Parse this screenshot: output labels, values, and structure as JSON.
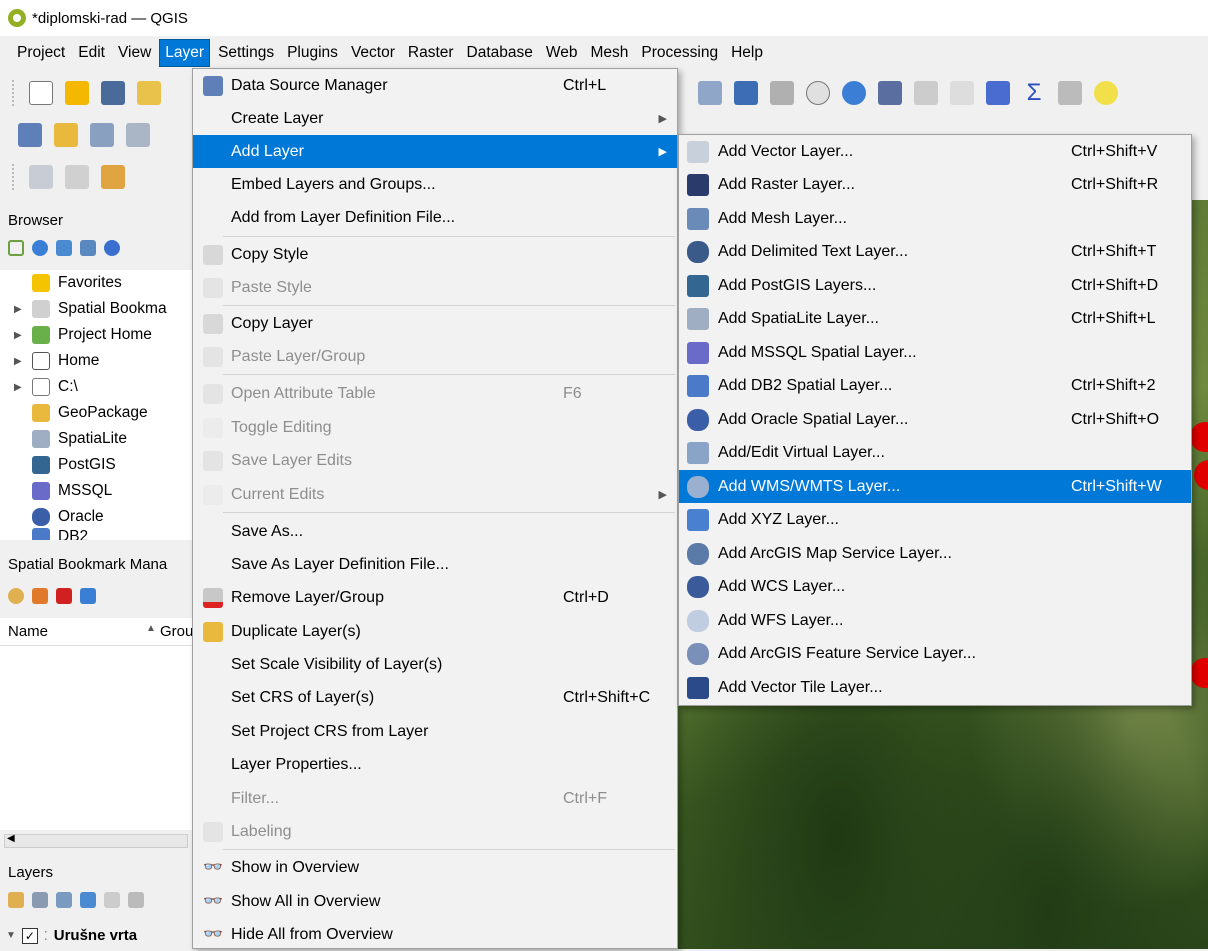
{
  "window": {
    "title": "*diplomski-rad — QGIS"
  },
  "menubar": [
    {
      "label": "Project"
    },
    {
      "label": "Edit"
    },
    {
      "label": "View"
    },
    {
      "label": "Layer"
    },
    {
      "label": "Settings"
    },
    {
      "label": "Plugins"
    },
    {
      "label": "Vector"
    },
    {
      "label": "Raster"
    },
    {
      "label": "Database"
    },
    {
      "label": "Web"
    },
    {
      "label": "Mesh"
    },
    {
      "label": "Processing"
    },
    {
      "label": "Help"
    }
  ],
  "browser": {
    "title": "Browser",
    "items": [
      {
        "label": "Favorites"
      },
      {
        "label": "Spatial Bookma"
      },
      {
        "label": "Project Home"
      },
      {
        "label": "Home"
      },
      {
        "label": "C:\\"
      },
      {
        "label": "GeoPackage"
      },
      {
        "label": "SpatiaLite"
      },
      {
        "label": "PostGIS"
      },
      {
        "label": "MSSQL"
      },
      {
        "label": "Oracle"
      },
      {
        "label": "DB2"
      }
    ]
  },
  "bookmarks": {
    "title": "Spatial Bookmark Mana",
    "col_name": "Name",
    "col_group": "Grou"
  },
  "layers_panel": {
    "title": "Layers",
    "layer_name": "Urušne vrta"
  },
  "layer_menu": {
    "items": [
      {
        "label": "Data Source Manager",
        "shortcut": "Ctrl+L"
      },
      {
        "label": "Create Layer"
      },
      {
        "label": "Add Layer"
      },
      {
        "label": "Embed Layers and Groups..."
      },
      {
        "label": "Add from Layer Definition File..."
      },
      {
        "label": "Copy Style"
      },
      {
        "label": "Paste Style"
      },
      {
        "label": "Copy Layer"
      },
      {
        "label": "Paste Layer/Group"
      },
      {
        "label": "Open Attribute Table",
        "shortcut": "F6"
      },
      {
        "label": "Toggle Editing"
      },
      {
        "label": "Save Layer Edits"
      },
      {
        "label": "Current Edits"
      },
      {
        "label": "Save As..."
      },
      {
        "label": "Save As Layer Definition File..."
      },
      {
        "label": "Remove Layer/Group",
        "shortcut": "Ctrl+D"
      },
      {
        "label": "Duplicate Layer(s)"
      },
      {
        "label": "Set Scale Visibility of Layer(s)"
      },
      {
        "label": "Set CRS of Layer(s)",
        "shortcut": "Ctrl+Shift+C"
      },
      {
        "label": "Set Project CRS from Layer"
      },
      {
        "label": "Layer Properties..."
      },
      {
        "label": "Filter...",
        "shortcut": "Ctrl+F"
      },
      {
        "label": "Labeling"
      },
      {
        "label": "Show in Overview"
      },
      {
        "label": "Show All in Overview"
      },
      {
        "label": "Hide All from Overview"
      }
    ]
  },
  "add_layer_menu": {
    "items": [
      {
        "label": "Add Vector Layer...",
        "shortcut": "Ctrl+Shift+V"
      },
      {
        "label": "Add Raster Layer...",
        "shortcut": "Ctrl+Shift+R"
      },
      {
        "label": "Add Mesh Layer..."
      },
      {
        "label": "Add Delimited Text Layer...",
        "shortcut": "Ctrl+Shift+T"
      },
      {
        "label": "Add PostGIS Layers...",
        "shortcut": "Ctrl+Shift+D"
      },
      {
        "label": "Add SpatiaLite Layer...",
        "shortcut": "Ctrl+Shift+L"
      },
      {
        "label": "Add MSSQL Spatial Layer..."
      },
      {
        "label": "Add DB2 Spatial Layer...",
        "shortcut": "Ctrl+Shift+2"
      },
      {
        "label": "Add Oracle Spatial Layer...",
        "shortcut": "Ctrl+Shift+O"
      },
      {
        "label": "Add/Edit Virtual Layer..."
      },
      {
        "label": "Add WMS/WMTS Layer...",
        "shortcut": "Ctrl+Shift+W"
      },
      {
        "label": "Add XYZ Layer..."
      },
      {
        "label": "Add ArcGIS Map Service Layer..."
      },
      {
        "label": "Add WCS Layer..."
      },
      {
        "label": "Add WFS Layer..."
      },
      {
        "label": "Add ArcGIS Feature Service Layer..."
      },
      {
        "label": "Add Vector Tile Layer..."
      }
    ]
  },
  "colors": {
    "selection": "#0078d7",
    "menu_bg": "#f2f2f2",
    "disabled": "#8e8e8e"
  }
}
